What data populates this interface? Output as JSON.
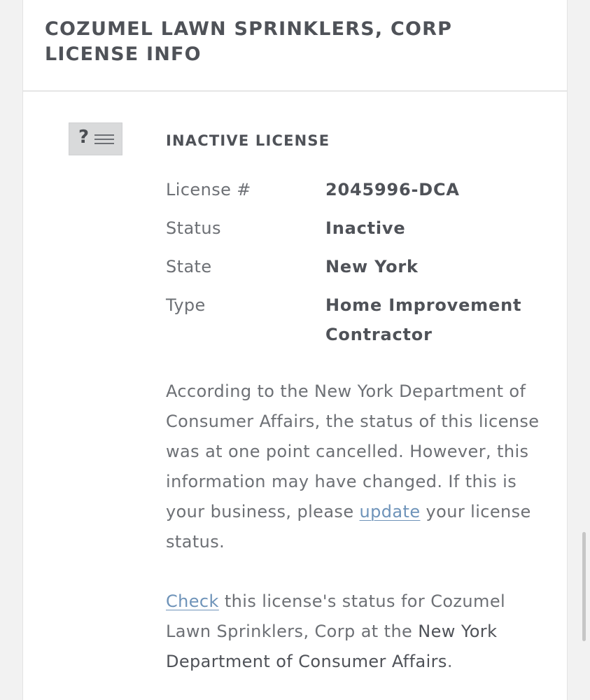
{
  "card": {
    "title": "COZUMEL LAWN SPRINKLERS, CORP LICENSE INFO"
  },
  "badge": {
    "icon": "question-list-icon",
    "glyph": "?"
  },
  "license": {
    "heading": "INACTIVE LICENSE",
    "rows": [
      {
        "label": "License #",
        "value": "2045996-DCA"
      },
      {
        "label": "Status",
        "value": "Inactive"
      },
      {
        "label": "State",
        "value": "New York"
      },
      {
        "label": "Type",
        "value": "Home Improvement Contractor"
      }
    ]
  },
  "notice": {
    "text_before_link": "According to the New York Department of Consumer Affairs, the status of this license was at one point cancelled. However, this information may have changed. If this is your business, please ",
    "link_label": "update",
    "text_after_link": " your license status."
  },
  "check": {
    "link_label": "Check",
    "text_middle": " this license's status for Cozumel Lawn Sprinklers, Corp at the ",
    "agency": "New York Department of Consumer Affairs",
    "text_end": "."
  },
  "colors": {
    "link": "#6e93b9",
    "heading_text": "#4f5258",
    "body_text": "#6d7075",
    "badge_background": "#d9dadb"
  }
}
